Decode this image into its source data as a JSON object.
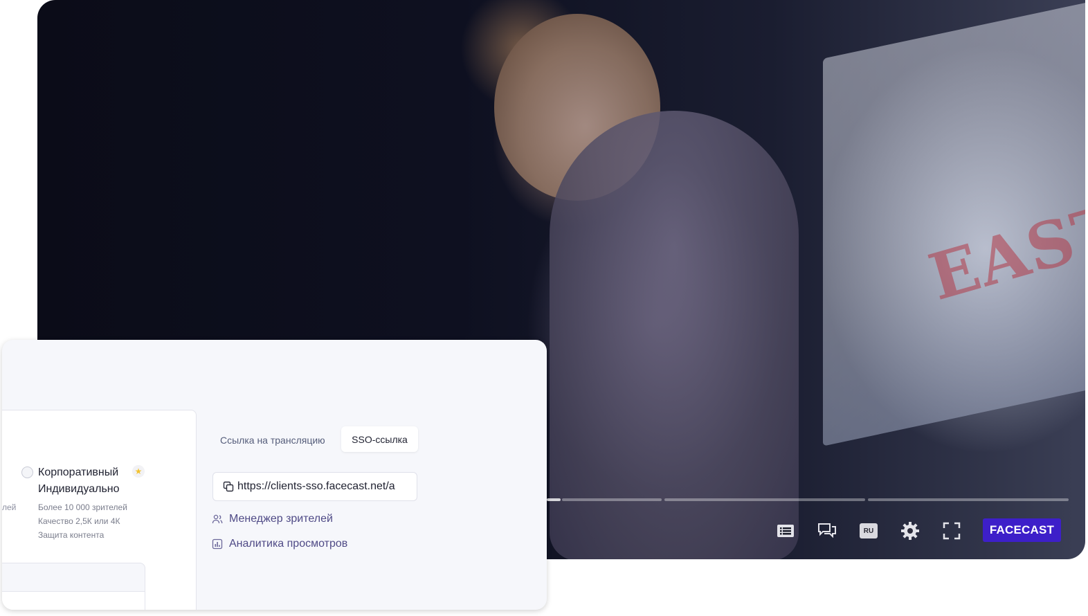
{
  "player": {
    "screen_text": "EASTE",
    "progress_played_fraction": 0.015,
    "controls": {
      "playlist_icon": "list-icon",
      "chat_icon": "chat-bubbles-icon",
      "language_label": "RU",
      "settings_icon": "gear-icon",
      "fullscreen_icon": "fullscreen-icon"
    },
    "brand_label": "FACECAST",
    "brand_color": "#3d1fc9"
  },
  "card": {
    "plan": {
      "cut_text": "лей",
      "title_line1": "Корпоративный",
      "title_line2": "Индивидуально",
      "features": [
        "Более 10 000 зрителей",
        "Качество 2,5К или 4К",
        "Защита контента"
      ],
      "star_icon": "star-icon"
    },
    "tabs": {
      "stream_link": "Ссылка на трансляцию",
      "sso_link": "SSO-ссылка"
    },
    "url_value": "https://clients-sso.facecast.net/a",
    "menu": {
      "viewer_manager": "Менеджер зрителей",
      "view_analytics": "Аналитика просмотров"
    }
  }
}
